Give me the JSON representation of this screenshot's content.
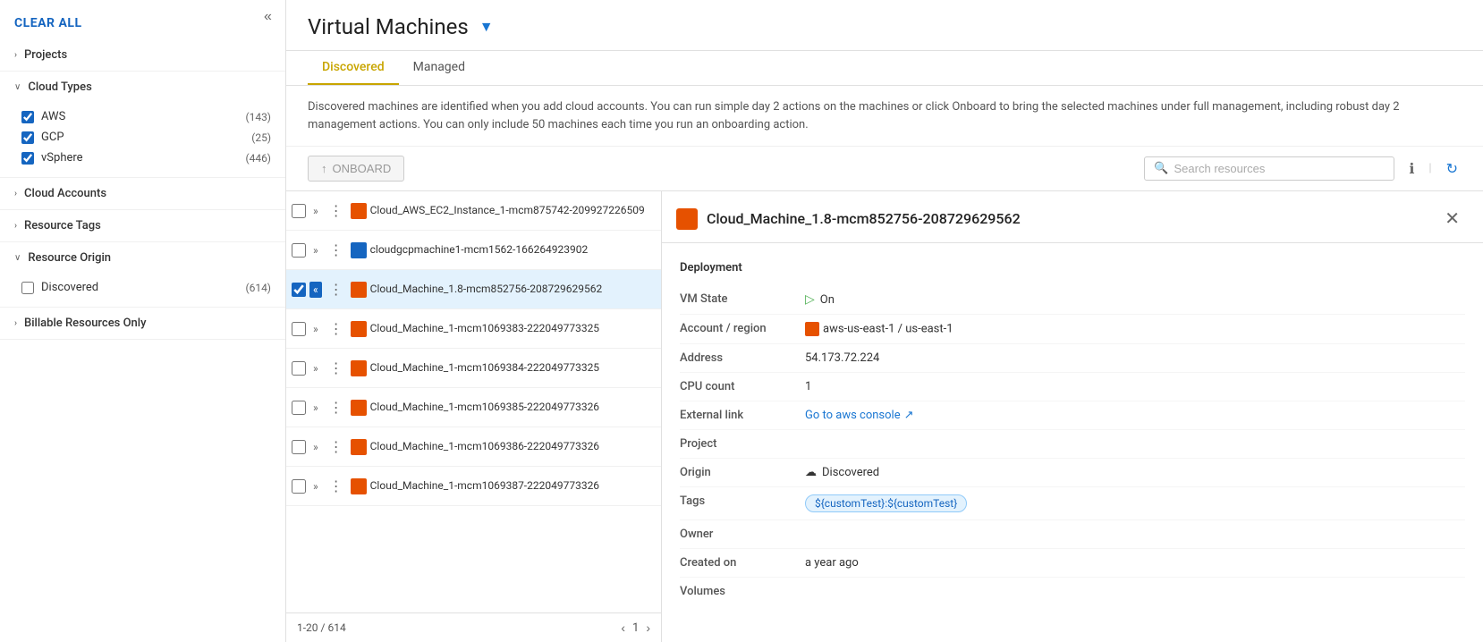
{
  "sidebar": {
    "clear_all_label": "CLEAR ALL",
    "collapse_icon": "«",
    "sections": [
      {
        "id": "projects",
        "label": "Projects",
        "expanded": false,
        "items": []
      },
      {
        "id": "cloud_types",
        "label": "Cloud Types",
        "expanded": true,
        "items": [
          {
            "label": "AWS",
            "count": "(143)",
            "checked": true
          },
          {
            "label": "GCP",
            "count": "(25)",
            "checked": true
          },
          {
            "label": "vSphere",
            "count": "(446)",
            "checked": true
          }
        ]
      },
      {
        "id": "cloud_accounts",
        "label": "Cloud Accounts",
        "expanded": false,
        "items": []
      },
      {
        "id": "resource_tags",
        "label": "Resource Tags",
        "expanded": false,
        "items": []
      },
      {
        "id": "resource_origin",
        "label": "Resource Origin",
        "expanded": true,
        "items": []
      },
      {
        "id": "discovered",
        "label": "Discovered",
        "expanded": false,
        "count": "(614)",
        "checked": false
      },
      {
        "id": "billable",
        "label": "Billable Resources Only",
        "expanded": false,
        "items": []
      }
    ]
  },
  "page": {
    "title": "Virtual Machines",
    "filter_icon": "▼"
  },
  "tabs": [
    {
      "id": "discovered",
      "label": "Discovered",
      "active": true
    },
    {
      "id": "managed",
      "label": "Managed",
      "active": false
    }
  ],
  "description": "Discovered machines are identified when you add cloud accounts. You can run simple day 2 actions on the machines or click Onboard to bring the selected machines under full management, including robust day 2 management actions. You can only include 50 machines each time you run an onboarding action.",
  "toolbar": {
    "onboard_label": "ONBOARD",
    "search_placeholder": "Search resources"
  },
  "resource_list": {
    "pagination_text": "1-20 / 614",
    "page_number": "1",
    "rows": [
      {
        "id": 1,
        "name": "Cloud_AWS_EC2_Instance_1-mcm875742-209927226509",
        "type": "aws",
        "selected": false,
        "active_expand": false
      },
      {
        "id": 2,
        "name": "cloudgcpmachine1-mcm1562-166264923902",
        "type": "gcp",
        "selected": false,
        "active_expand": false
      },
      {
        "id": 3,
        "name": "Cloud_Machine_1.8-mcm852756-208729629562",
        "type": "aws",
        "selected": true,
        "active_expand": true
      },
      {
        "id": 4,
        "name": "Cloud_Machine_1-mcm1069383-222049773325",
        "type": "aws",
        "selected": false,
        "active_expand": false
      },
      {
        "id": 5,
        "name": "Cloud_Machine_1-mcm1069384-222049773325",
        "type": "aws",
        "selected": false,
        "active_expand": false
      },
      {
        "id": 6,
        "name": "Cloud_Machine_1-mcm1069385-222049773326",
        "type": "aws",
        "selected": false,
        "active_expand": false
      },
      {
        "id": 7,
        "name": "Cloud_Machine_1-mcm1069386-222049773326",
        "type": "aws",
        "selected": false,
        "active_expand": false
      },
      {
        "id": 8,
        "name": "Cloud_Machine_1-mcm1069387-222049773326",
        "type": "aws",
        "selected": false,
        "active_expand": false
      }
    ]
  },
  "detail": {
    "title": "Cloud_Machine_1.8-mcm852756-208729629562",
    "icon_type": "aws",
    "section_title": "Deployment",
    "fields": [
      {
        "key": "VM State",
        "value": "On",
        "type": "vm-state"
      },
      {
        "key": "Account / region",
        "value": "aws-us-east-1 / us-east-1",
        "type": "account"
      },
      {
        "key": "Address",
        "value": "54.173.72.224",
        "type": "text"
      },
      {
        "key": "CPU count",
        "value": "1",
        "type": "text"
      },
      {
        "key": "External link",
        "value": "Go to aws console",
        "type": "link"
      },
      {
        "key": "Project",
        "value": "",
        "type": "text"
      },
      {
        "key": "Origin",
        "value": "Discovered",
        "type": "origin"
      },
      {
        "key": "Tags",
        "value": "${customTest}:${customTest}",
        "type": "tag"
      },
      {
        "key": "Owner",
        "value": "",
        "type": "text"
      },
      {
        "key": "Created on",
        "value": "a year ago",
        "type": "text"
      },
      {
        "key": "Volumes",
        "value": "",
        "type": "text"
      }
    ]
  },
  "colors": {
    "tab_active": "#c8a500",
    "aws_icon": "#e65100",
    "gcp_icon": "#1565c0",
    "link": "#1976d2",
    "vm_on": "#4caf50",
    "tag_bg": "#e3f2fd",
    "tag_border": "#90caf9",
    "selected_row": "#e3f2fd"
  }
}
